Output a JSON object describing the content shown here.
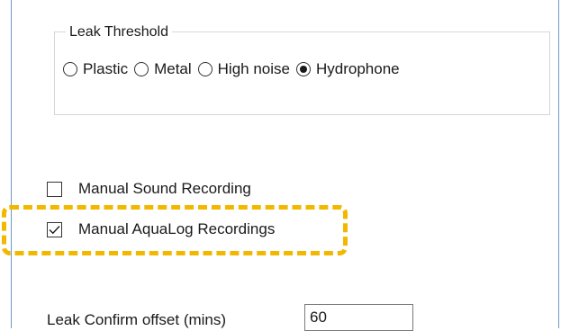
{
  "leak_threshold": {
    "legend": "Leak Threshold",
    "options": [
      {
        "label": "Plastic",
        "selected": false
      },
      {
        "label": "Metal",
        "selected": false
      },
      {
        "label": "High noise",
        "selected": false
      },
      {
        "label": "Hydrophone",
        "selected": true
      }
    ]
  },
  "manual_sound_recording": {
    "label": "Manual Sound Recording",
    "checked": false
  },
  "manual_aqualog_recordings": {
    "label": "Manual AquaLog Recordings",
    "checked": true
  },
  "leak_confirm_offset": {
    "label": "Leak Confirm offset (mins)",
    "value": "60"
  },
  "colors": {
    "highlight": "#f2b800",
    "frame": "#6f98c9"
  }
}
